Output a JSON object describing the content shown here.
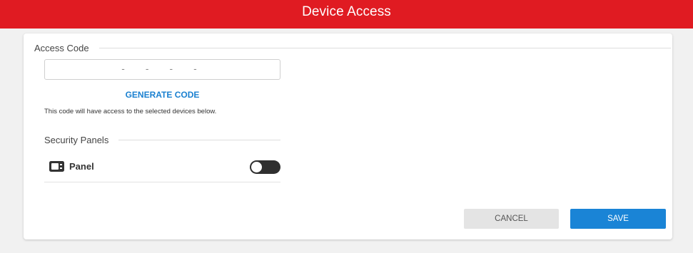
{
  "header": {
    "title": "Device Access"
  },
  "access_code": {
    "section_title": "Access Code",
    "value": "- - - -",
    "generate_label": "GENERATE CODE",
    "hint": "This code will have access to the selected devices below."
  },
  "security_panels": {
    "section_title": "Security Panels",
    "items": [
      {
        "icon": "panel-icon",
        "label": "Panel",
        "enabled": false
      }
    ]
  },
  "actions": {
    "cancel_label": "CANCEL",
    "save_label": "SAVE"
  },
  "colors": {
    "header_bg": "#e01b22",
    "link": "#1a80d0",
    "save_bg": "#1a84d6",
    "toggle_off": "#2f2f2f"
  }
}
